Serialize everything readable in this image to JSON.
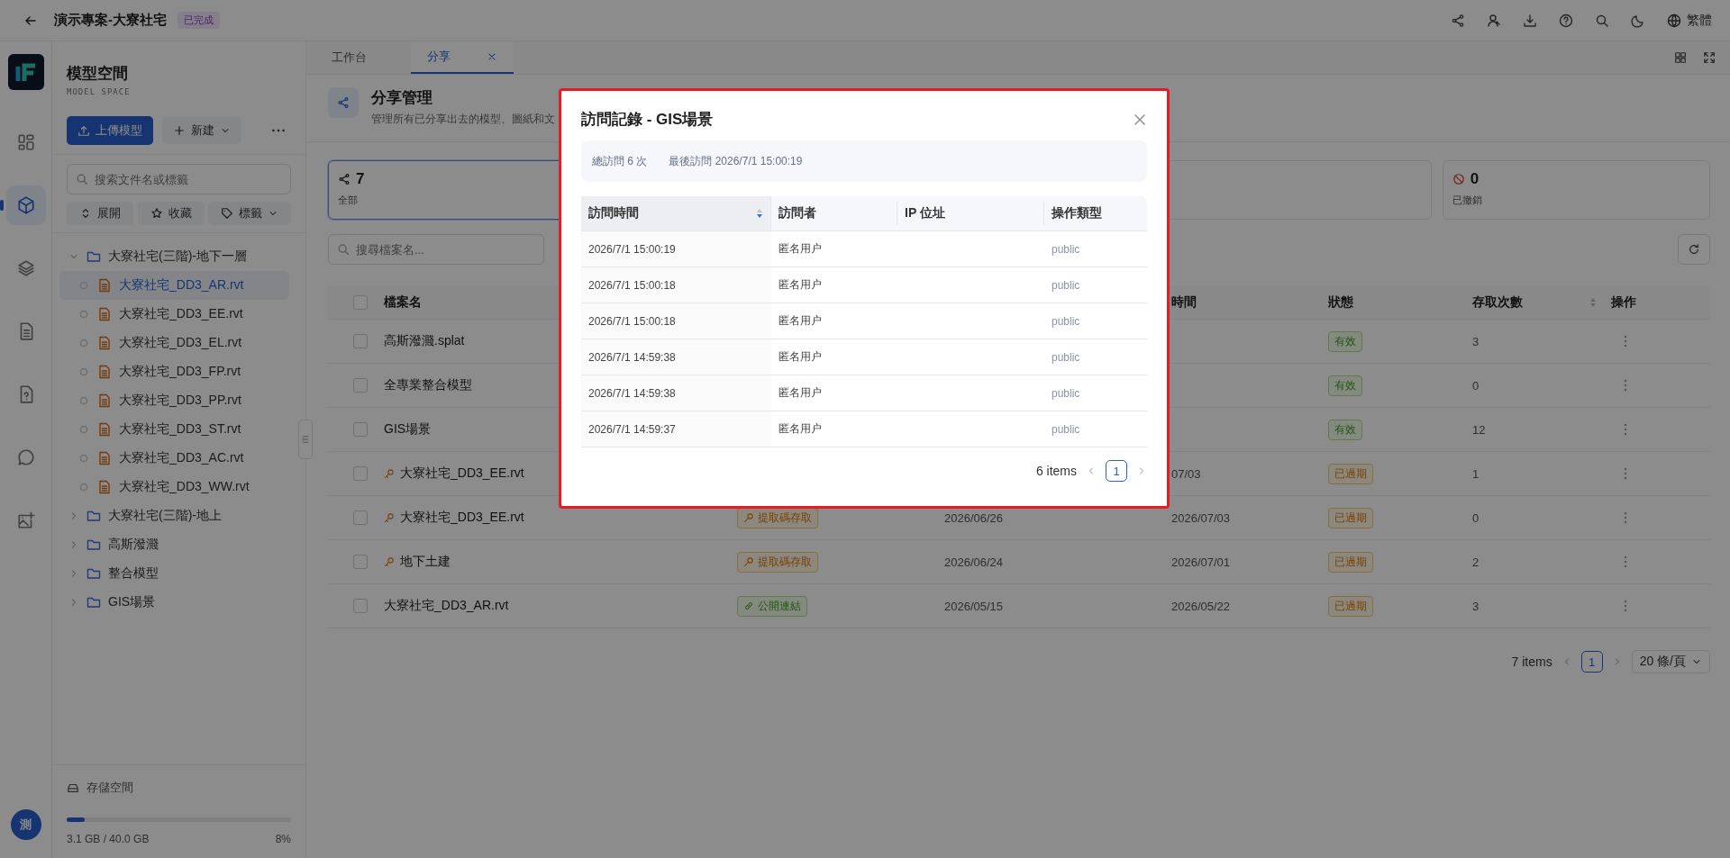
{
  "topbar": {
    "title": "演示專案-大寮社宅",
    "badge": "已完成",
    "language": "繁體"
  },
  "rail": {
    "items": [
      {
        "selected": false
      },
      {
        "selected": true
      },
      {
        "selected": false
      },
      {
        "selected": false
      },
      {
        "selected": false
      },
      {
        "selected": false
      },
      {
        "selected": false
      }
    ],
    "avatar": "測"
  },
  "sidebar": {
    "title": "模型空間",
    "subtitle": "MODEL SPACE",
    "upload": "上傳模型",
    "new": "新建",
    "search_placeholder": "搜索文件名或標籤",
    "filters": [
      {
        "label": "展開",
        "dropdown": false
      },
      {
        "label": "收藏",
        "dropdown": false
      },
      {
        "label": "標籤",
        "dropdown": true
      }
    ],
    "tree": [
      {
        "label": "大寮社宅(三階)-地下一層",
        "expanded": true,
        "children": [
          {
            "label": "大寮社宅_DD3_AR.rvt",
            "selected": true
          },
          {
            "label": "大寮社宅_DD3_EE.rvt",
            "selected": false
          },
          {
            "label": "大寮社宅_DD3_EL.rvt",
            "selected": false
          },
          {
            "label": "大寮社宅_DD3_FP.rvt",
            "selected": false
          },
          {
            "label": "大寮社宅_DD3_PP.rvt",
            "selected": false
          },
          {
            "label": "大寮社宅_DD3_ST.rvt",
            "selected": false
          },
          {
            "label": "大寮社宅_DD3_AC.rvt",
            "selected": false
          },
          {
            "label": "大寮社宅_DD3_WW.rvt",
            "selected": false
          }
        ]
      },
      {
        "label": "大寮社宅(三階)-地上",
        "expanded": false
      },
      {
        "label": "高斯潑濺",
        "expanded": false
      },
      {
        "label": "整合模型",
        "expanded": false
      },
      {
        "label": "GIS場景",
        "expanded": false
      }
    ],
    "storage": {
      "label": "存儲空間",
      "level": 0.08,
      "used": "3.1 GB / 40.0 GB",
      "percent": "8%"
    }
  },
  "tabs": [
    {
      "label": "工作台",
      "selected": false,
      "closable": false
    },
    {
      "label": "分享",
      "selected": true,
      "closable": true
    }
  ],
  "share": {
    "title": "分享管理",
    "description": "管理所有已分享出去的模型、圖紙和文",
    "stats": [
      {
        "count": "7",
        "label": "全部",
        "selected": true
      },
      {
        "count": "0",
        "label": "已撤銷",
        "selected": false
      }
    ],
    "search_placeholder": "搜尋檔案名...",
    "header": {
      "all_checked": false,
      "name": "檔案名",
      "expires": "時間",
      "status": "狀態",
      "count": "存取次數",
      "actions": "操作"
    },
    "rows": [
      {
        "checked": false,
        "access_key": false,
        "name": "高斯潑濺.splat",
        "status": {
          "kind": "valid",
          "label": "有效"
        },
        "count": "3"
      },
      {
        "checked": false,
        "access_key": false,
        "name": "全專業整合模型",
        "status": {
          "kind": "valid",
          "label": "有效"
        },
        "count": "0"
      },
      {
        "checked": false,
        "access_key": false,
        "name": "GIS場景",
        "status": {
          "kind": "valid",
          "label": "有效"
        },
        "count": "12"
      },
      {
        "checked": false,
        "access_key": true,
        "name": "大寮社宅_DD3_EE.rvt",
        "expires": "07/03",
        "status": {
          "kind": "expired",
          "label": "已過期"
        },
        "count": "1"
      },
      {
        "checked": false,
        "access_key": true,
        "name": "大寮社宅_DD3_EE.rvt",
        "type": {
          "kind": "code",
          "label": "提取碼存取"
        },
        "created": "2026/06/26",
        "expires": "2026/07/03",
        "status": {
          "kind": "expired",
          "label": "已過期"
        },
        "count": "0"
      },
      {
        "checked": false,
        "access_key": true,
        "name": "地下土建",
        "type": {
          "kind": "code",
          "label": "提取碼存取"
        },
        "created": "2026/06/24",
        "expires": "2026/07/01",
        "status": {
          "kind": "expired",
          "label": "已過期"
        },
        "count": "2"
      },
      {
        "checked": false,
        "access_key": false,
        "name": "大寮社宅_DD3_AR.rvt",
        "type": {
          "kind": "link",
          "label": "公開連結"
        },
        "created": "2026/05/15",
        "expires": "2026/05/22",
        "status": {
          "kind": "expired",
          "label": "已過期"
        },
        "count": "3"
      }
    ],
    "footer": {
      "total": "7 items",
      "page": "1",
      "page_size": "20 條/頁"
    }
  },
  "modal": {
    "title": "訪問記錄 - GIS場景",
    "total": "總訪問 6 次",
    "last": "最後訪問 2026/7/1 15:00:19",
    "columns": [
      {
        "label": "訪問時間",
        "sorted": true
      },
      {
        "label": "訪問者",
        "sorted": false
      },
      {
        "label": "IP 位址",
        "sorted": false
      },
      {
        "label": "操作類型",
        "sorted": false
      }
    ],
    "rows": [
      {
        "time": "2026/7/1 15:00:19",
        "visitor": "匿名用户",
        "action": "public"
      },
      {
        "time": "2026/7/1 15:00:18",
        "visitor": "匿名用户",
        "action": "public"
      },
      {
        "time": "2026/7/1 15:00:18",
        "visitor": "匿名用户",
        "action": "public"
      },
      {
        "time": "2026/7/1 14:59:38",
        "visitor": "匿名用户",
        "action": "public"
      },
      {
        "time": "2026/7/1 14:59:38",
        "visitor": "匿名用户",
        "action": "public"
      },
      {
        "time": "2026/7/1 14:59:37",
        "visitor": "匿名用户",
        "action": "public"
      }
    ],
    "footer": {
      "total": "6 items",
      "page": "1"
    }
  }
}
